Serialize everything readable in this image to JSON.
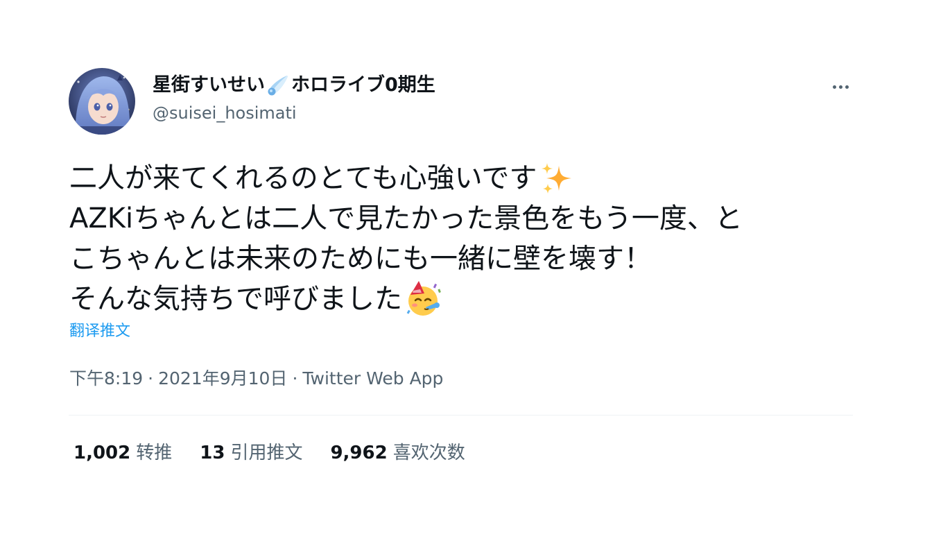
{
  "author": {
    "display_name_prefix": "星街すいせい",
    "display_name_suffix": "ホロライブ0期生",
    "name_icon": "comet-icon",
    "handle": "@suisei_hosimati",
    "avatar_icon": "avatar-image"
  },
  "more_icon": "more-icon",
  "tweet": {
    "lines": [
      {
        "text": "二人が来てくれるのとても心強いです",
        "emoji": "sparkles-emoji"
      },
      {
        "text": "AZKiちゃんとは二人で見たかった景色をもう一度、と"
      },
      {
        "text": "こちゃんとは未来のためにも一緒に壁を壊す！"
      },
      {
        "text": "そんな気持ちで呼びました",
        "emoji": "partying-face-emoji"
      }
    ],
    "translate_label": "翻译推文"
  },
  "meta": {
    "time": "下午8:19",
    "date": "2021年9月10日",
    "separator": "·",
    "source": "Twitter Web App"
  },
  "stats": {
    "retweets_count": "1,002",
    "retweets_label": "转推",
    "quotes_count": "13",
    "quotes_label": "引用推文",
    "likes_count": "9,962",
    "likes_label": "喜欢次数"
  },
  "colors": {
    "text_primary": "#0f1419",
    "text_secondary": "#536471",
    "link": "#1d9bf0",
    "divider": "#eff3f4"
  }
}
